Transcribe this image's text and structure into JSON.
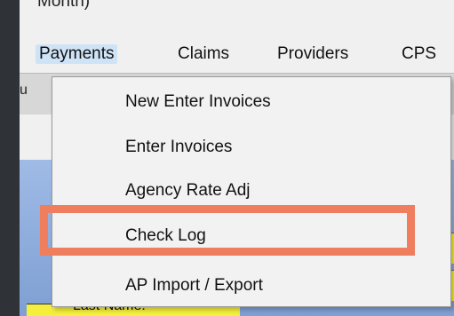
{
  "window": {
    "title_fragment": "Month)",
    "background_label": "u"
  },
  "menubar": {
    "items": [
      {
        "label": "Payments",
        "active": true
      },
      {
        "label": "Claims"
      },
      {
        "label": "Providers"
      },
      {
        "label": "CPS"
      }
    ]
  },
  "payments_menu": {
    "items": [
      {
        "label": "New Enter Invoices"
      },
      {
        "label": "Enter Invoices"
      },
      {
        "label": "Agency Rate Adj"
      },
      {
        "label": "Check Log",
        "highlighted": true
      },
      {
        "label": "AP Import / Export"
      }
    ]
  },
  "background": {
    "bottom_field_label": "Last Name:"
  },
  "colors": {
    "highlight_outline": "#ef7e5f",
    "menu_active": "#cfe3f7",
    "field_yellow": "#f5f224"
  }
}
